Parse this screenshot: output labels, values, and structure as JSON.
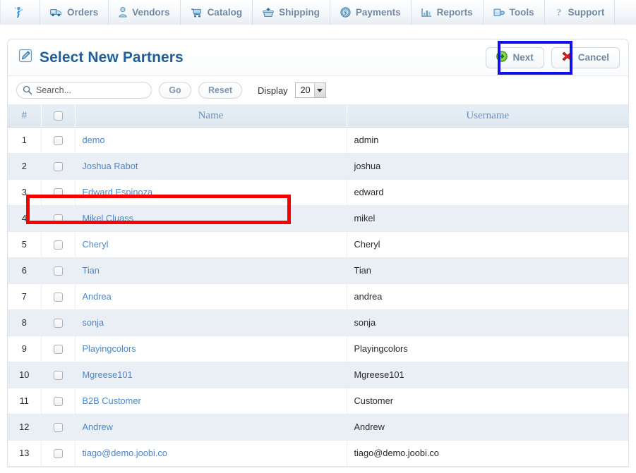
{
  "topnav": {
    "items": [
      {
        "label": "",
        "icon": "logo-runner-icon"
      },
      {
        "label": "Orders",
        "icon": "truck-icon"
      },
      {
        "label": "Vendors",
        "icon": "person-icon"
      },
      {
        "label": "Catalog",
        "icon": "shopping-cart-icon"
      },
      {
        "label": "Shipping",
        "icon": "package-icon"
      },
      {
        "label": "Payments",
        "icon": "coin-dollar-icon"
      },
      {
        "label": "Reports",
        "icon": "bar-chart-icon"
      },
      {
        "label": "Tools",
        "icon": "wrench-icon"
      },
      {
        "label": "Support",
        "icon": "question-mark-icon"
      }
    ]
  },
  "header": {
    "title": "Select New Partners",
    "title_icon": "pencil-edit-icon",
    "next_label": "Next",
    "next_icon": "green-arrow-right-icon",
    "cancel_label": "Cancel",
    "cancel_icon": "red-x-icon"
  },
  "toolbar": {
    "search_placeholder": "Search...",
    "search_value": "",
    "search_icon": "magnifier-icon",
    "go_label": "Go",
    "reset_label": "Reset",
    "display_label": "Display",
    "display_value": "20",
    "display_options": [
      "20"
    ]
  },
  "table": {
    "columns": [
      "#",
      "",
      "Name",
      "Username"
    ],
    "rows": [
      {
        "num": "1",
        "name": "demo",
        "username": "admin"
      },
      {
        "num": "2",
        "name": "Joshua Rabot",
        "username": "joshua"
      },
      {
        "num": "3",
        "name": "Edward Espinoza",
        "username": "edward"
      },
      {
        "num": "4",
        "name": "Mikel Cluass",
        "username": "mikel"
      },
      {
        "num": "5",
        "name": "Cheryl",
        "username": "Cheryl"
      },
      {
        "num": "6",
        "name": "Tian",
        "username": "Tian"
      },
      {
        "num": "7",
        "name": "Andrea",
        "username": "andrea"
      },
      {
        "num": "8",
        "name": "sonja",
        "username": "sonja"
      },
      {
        "num": "9",
        "name": "Playingcolors",
        "username": "Playingcolors"
      },
      {
        "num": "10",
        "name": "Mgreese101",
        "username": "Mgreese101"
      },
      {
        "num": "11",
        "name": "B2B Customer",
        "username": "Customer"
      },
      {
        "num": "12",
        "name": "Andrew",
        "username": "Andrew"
      },
      {
        "num": "13",
        "name": "tiago@demo.joobi.co",
        "username": "tiago@demo.joobi.co"
      }
    ]
  },
  "annotations": {
    "red_box_target": "row-1-name-cell",
    "red_box_color": "#f60000",
    "blue_box_target": "next-button",
    "blue_box_color": "#1210e8"
  },
  "colors": {
    "nav_text": "#6f89a6",
    "title": "#1f5f9c",
    "link": "#4f86c6",
    "header_bg": "#e3ebf4",
    "row_alt_bg": "#eaeff5"
  }
}
